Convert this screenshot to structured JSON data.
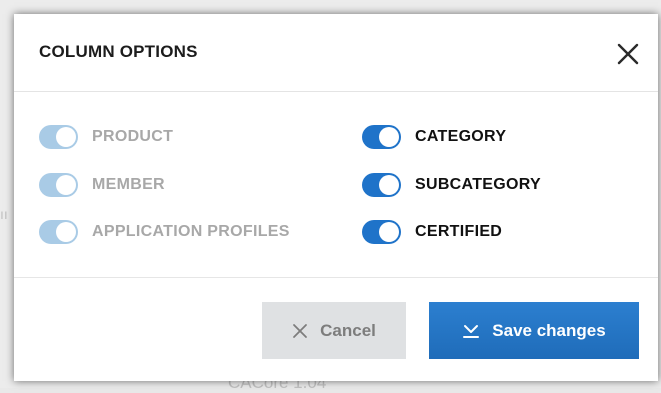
{
  "background": {
    "partial_text_left": "ıı",
    "partial_text_bottom": "CACore 1.04"
  },
  "modal": {
    "title": "COLUMN OPTIONS",
    "close_icon": "close-icon",
    "options_left": [
      {
        "label": "PRODUCT",
        "state": "on-disabled"
      },
      {
        "label": "MEMBER",
        "state": "on-disabled"
      },
      {
        "label": "APPLICATION PROFILES",
        "state": "on-disabled"
      }
    ],
    "options_right": [
      {
        "label": "CATEGORY",
        "state": "on"
      },
      {
        "label": "SUBCATEGORY",
        "state": "on"
      },
      {
        "label": "CERTIFIED",
        "state": "on"
      }
    ],
    "cancel_label": "Cancel",
    "cancel_icon": "x-icon",
    "save_label": "Save changes",
    "save_icon": "download-check-icon"
  },
  "colors": {
    "toggle_on": "#1f73c9",
    "toggle_disabled": "#a9cbe6",
    "save_button": "#2375c6",
    "cancel_button": "#dfe1e3"
  }
}
